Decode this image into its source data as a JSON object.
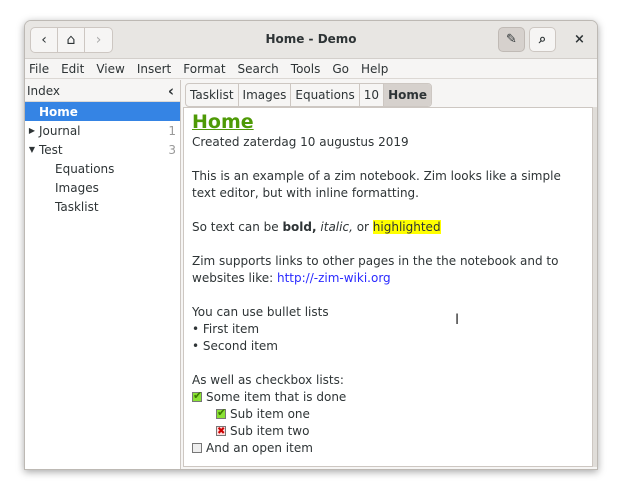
{
  "window": {
    "title": "Home - Demo"
  },
  "toolbar": {
    "back": "‹",
    "home": "⌂",
    "forward": "›",
    "edit": "✎",
    "search": "⌕",
    "close": "×"
  },
  "menu": [
    "File",
    "Edit",
    "View",
    "Insert",
    "Format",
    "Search",
    "Tools",
    "Go",
    "Help"
  ],
  "sidebar": {
    "title": "Index",
    "collapse": "‹",
    "items": [
      {
        "label": "Home",
        "selected": true
      },
      {
        "label": "Journal",
        "count": "1",
        "expander": "▶"
      },
      {
        "label": "Test",
        "count": "3",
        "expander": "▼"
      },
      {
        "label": "Equations"
      },
      {
        "label": "Images"
      },
      {
        "label": "Tasklist"
      }
    ]
  },
  "tabs": [
    "Tasklist",
    "Images",
    "Equations",
    "10",
    "Home"
  ],
  "page": {
    "heading": "Home",
    "created": "Created zaterdag 10 augustus 2019",
    "p1": "This is an example of a zim notebook. Zim looks like a simple text editor, but with inline formatting.",
    "p2_pre": "So text can be ",
    "p2_bold": "bold,",
    "p2_sp": " ",
    "p2_italic": "italic,",
    "p2_or": " or ",
    "p2_hl": "highlighted",
    "p3_pre": "Zim supports links to other pages in the the notebook and to websites like: ",
    "p3_link": "http://-zim-wiki.org",
    "bullets_intro": "You can use bullet lists",
    "bullets": [
      "• First item",
      "• Second item"
    ],
    "check_intro": "As well as checkbox lists:",
    "checks": [
      {
        "label": "Some item that is done",
        "state": "done"
      },
      {
        "label": "Sub item one",
        "state": "done"
      },
      {
        "label": "Sub item two",
        "state": "cancelled"
      },
      {
        "label": "And an open item",
        "state": "open"
      }
    ]
  },
  "colors": {
    "accent": "#3584e4",
    "heading": "#4e9a06",
    "link": "#2a2aff",
    "highlight": "#ffff00"
  }
}
